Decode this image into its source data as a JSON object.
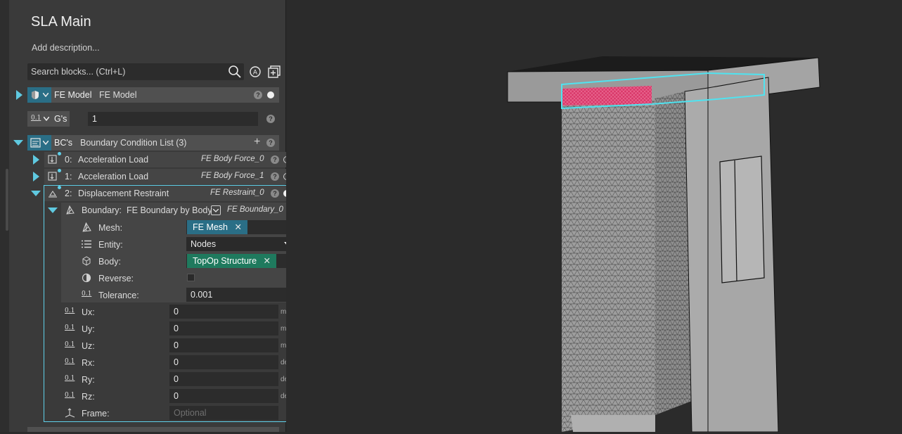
{
  "panel": {
    "title": "SLA Main",
    "description_placeholder": "Add description...",
    "search_placeholder": "Search blocks... (Ctrl+L)"
  },
  "fe_model": {
    "tag": "FE Model",
    "value": "FE Model"
  },
  "gs": {
    "icon_text": "0.1",
    "tag": "G's",
    "value": "1"
  },
  "bcs": {
    "tag": "BC's",
    "title": "Boundary Condition List (3)",
    "items": [
      {
        "index": "0:",
        "name": "Acceleration Load",
        "ref": "FE Body Force_0"
      },
      {
        "index": "1:",
        "name": "Acceleration Load",
        "ref": "FE Body Force_1"
      },
      {
        "index": "2:",
        "name": "Displacement Restraint",
        "ref": "FE Restraint_0"
      }
    ]
  },
  "boundary": {
    "label": "Boundary:",
    "type": "FE Boundary by Body",
    "ref": "FE Boundary_0",
    "mesh_label": "Mesh:",
    "mesh_chip": "FE Mesh",
    "entity_label": "Entity:",
    "entity_value": "Nodes",
    "body_label": "Body:",
    "body_chip": "TopOp Structure",
    "reverse_label": "Reverse:",
    "tolerance_label": "Tolerance:",
    "tolerance_value": "0.001",
    "tolerance_unit": "mm"
  },
  "restraints": [
    {
      "label": "Ux:",
      "value": "0",
      "unit": "mm"
    },
    {
      "label": "Uy:",
      "value": "0",
      "unit": "mm"
    },
    {
      "label": "Uz:",
      "value": "0",
      "unit": "mm"
    },
    {
      "label": "Rx:",
      "value": "0",
      "unit": "deg"
    },
    {
      "label": "Ry:",
      "value": "0",
      "unit": "deg"
    },
    {
      "label": "Rz:",
      "value": "0",
      "unit": "deg"
    }
  ],
  "frame": {
    "label": "Frame:",
    "placeholder": "Optional"
  },
  "num_icon_text": "0.1",
  "colors": {
    "accent": "#5fd0ea",
    "mesh_chip": "#2a6e86",
    "body_chip": "#1f7a5e",
    "selection": "#e0356a"
  }
}
